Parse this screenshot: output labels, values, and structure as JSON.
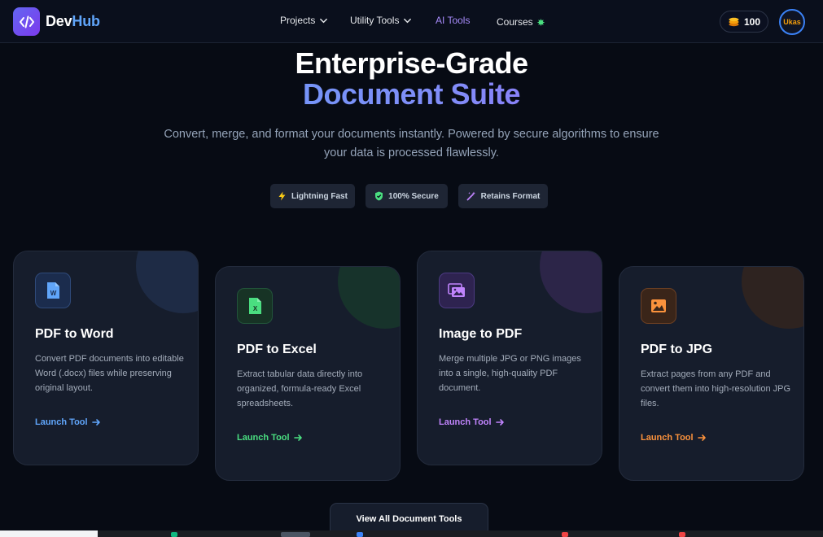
{
  "brand": {
    "name_part1": "Dev",
    "name_part2": "Hub"
  },
  "nav": {
    "projects": "Projects",
    "utility_tools": "Utility Tools",
    "ai_tools": "AI Tools",
    "courses": "Courses"
  },
  "user": {
    "coins": "100",
    "avatar_text": "Ukas"
  },
  "hero": {
    "title_line1": "Enterprise-Grade",
    "title_line2": "Document Suite",
    "subtitle": "Convert, merge, and format your documents instantly. Powered by secure algorithms to ensure your data is processed flawlessly."
  },
  "badges": [
    {
      "label": "Lightning Fast",
      "icon": "lightning-icon",
      "color": "#facc15"
    },
    {
      "label": "100% Secure",
      "icon": "shield-check-icon",
      "color": "#4ade80"
    },
    {
      "label": "Retains Format",
      "icon": "magic-wand-icon",
      "color": "#c084fc"
    }
  ],
  "cards": [
    {
      "title": "PDF to Word",
      "description": "Convert PDF documents into editable Word (.docx) files while preserving original layout.",
      "cta": "Launch Tool",
      "icon": "word-file-icon",
      "accent": "#60a5fa"
    },
    {
      "title": "PDF to Excel",
      "description": "Extract tabular data directly into organized, formula-ready Excel spreadsheets.",
      "cta": "Launch Tool",
      "icon": "excel-file-icon",
      "accent": "#4ade80"
    },
    {
      "title": "Image to PDF",
      "description": "Merge multiple JPG or PNG images into a single, high-quality PDF document.",
      "cta": "Launch Tool",
      "icon": "images-icon",
      "accent": "#c084fc"
    },
    {
      "title": "PDF to JPG",
      "description": "Extract pages from any PDF and convert them into high-resolution JPG files.",
      "cta": "Launch Tool",
      "icon": "image-icon",
      "accent": "#fb923c"
    }
  ],
  "view_all": "View All Document Tools"
}
